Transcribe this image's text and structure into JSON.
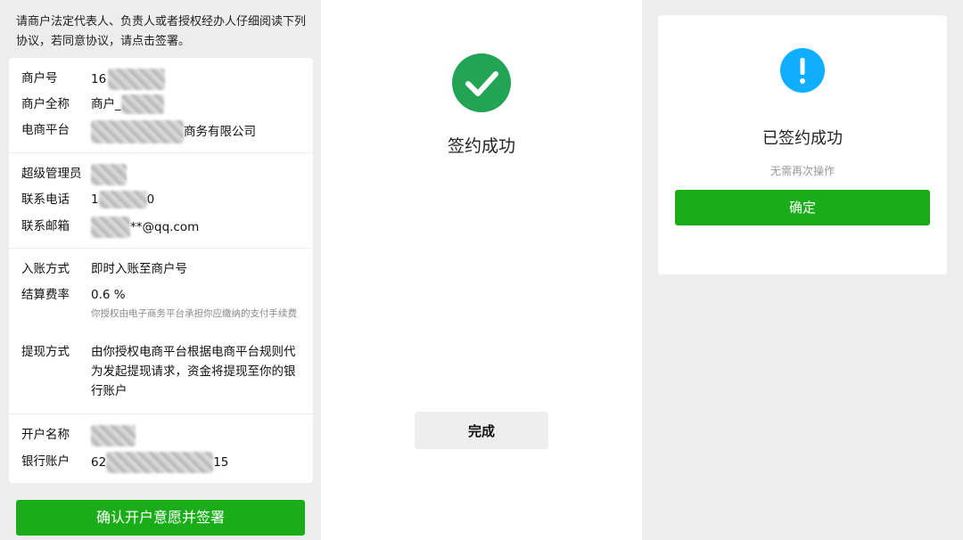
{
  "agreement": {
    "intro": "请商户法定代表人、负责人或者授权经办人仔细阅读下列协议，若同意协议，请点击签署。",
    "merchant": {
      "id_label": "商户号",
      "id_prefix": "16",
      "fullname_label": "商户全称",
      "fullname_prefix": "商户_",
      "platform_label": "电商平台",
      "platform_suffix": "商务有限公司"
    },
    "admin": {
      "admin_label": "超级管理员",
      "phone_label": "联系电话",
      "phone_prefix": "1",
      "phone_suffix": "0",
      "email_label": "联系邮箱",
      "email_suffix": "**@qq.com"
    },
    "settlement": {
      "method_label": "入账方式",
      "method_value": "即时入账至商户号",
      "rate_label": "结算费率",
      "rate_value": "0.6 %",
      "rate_note": "你授权由电子商务平台承担你应缴纳的支付手续费",
      "withdraw_label": "提现方式",
      "withdraw_value": "由你授权电商平台根据电商平台规则代为发起提现请求，资金将提现至你的银行账户"
    },
    "bank": {
      "name_label": "开户名称",
      "account_label": "银行账户",
      "account_prefix": "62",
      "account_suffix": "15"
    },
    "confirm_button": "确认开户意愿并签署"
  },
  "success": {
    "title": "签约成功",
    "done_button": "完成",
    "accent": "#21a453"
  },
  "already": {
    "title": "已签约成功",
    "subtitle": "无需再次操作",
    "ok_button": "确定",
    "accent": "#10aeff",
    "button_color": "#1aad19"
  }
}
